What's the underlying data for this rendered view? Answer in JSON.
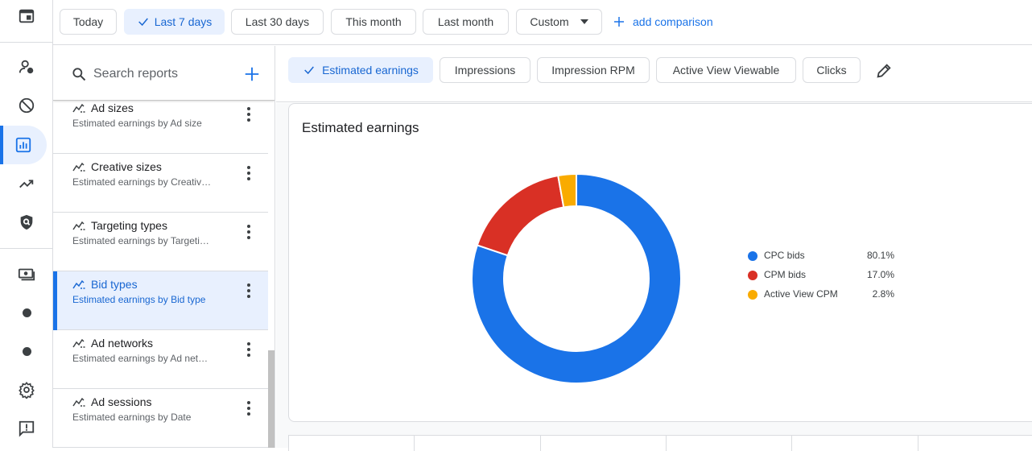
{
  "rail": {
    "items": [
      {
        "name": "home-icon"
      },
      {
        "name": "account-icon"
      },
      {
        "name": "block-icon"
      },
      {
        "name": "reports-icon"
      },
      {
        "name": "trend-icon"
      },
      {
        "name": "privacy-icon"
      },
      {
        "name": "payments-icon"
      },
      {
        "name": "dot-icon"
      },
      {
        "name": "dot-icon"
      },
      {
        "name": "settings-icon"
      },
      {
        "name": "feedback-icon"
      }
    ]
  },
  "date_filters": {
    "chips": [
      {
        "label": "Today",
        "selected": false
      },
      {
        "label": "Last 7 days",
        "selected": true
      },
      {
        "label": "Last 30 days",
        "selected": false
      },
      {
        "label": "This month",
        "selected": false
      },
      {
        "label": "Last month",
        "selected": false
      },
      {
        "label": "Custom",
        "selected": false
      }
    ],
    "add_comparison": "add comparison"
  },
  "reports": {
    "search_placeholder": "Search reports",
    "items": [
      {
        "title": "Ad sizes",
        "subtitle": "Estimated earnings by Ad size",
        "active": false
      },
      {
        "title": "Creative sizes",
        "subtitle": "Estimated earnings by Creativ…",
        "active": false
      },
      {
        "title": "Targeting types",
        "subtitle": "Estimated earnings by Targeti…",
        "active": false
      },
      {
        "title": "Bid types",
        "subtitle": "Estimated earnings by Bid type",
        "active": true
      },
      {
        "title": "Ad networks",
        "subtitle": "Estimated earnings by Ad net…",
        "active": false
      },
      {
        "title": "Ad sessions",
        "subtitle": "Estimated earnings by Date",
        "active": false
      }
    ]
  },
  "metrics": {
    "tabs": [
      {
        "label": "Estimated earnings",
        "selected": true
      },
      {
        "label": "Impressions",
        "selected": false
      },
      {
        "label": "Impression RPM",
        "selected": false
      },
      {
        "label": "Active View Viewable",
        "selected": false
      },
      {
        "label": "Clicks",
        "selected": false
      }
    ]
  },
  "chart_card": {
    "title": "Estimated earnings"
  },
  "chart_data": {
    "type": "pie",
    "title": "Estimated earnings",
    "categories": [
      "CPC bids",
      "CPM bids",
      "Active View CPM"
    ],
    "values": [
      80.1,
      17.0,
      2.8
    ],
    "labels": [
      "80.1%",
      "17.0%",
      "2.8%"
    ],
    "colors": [
      "#1a73e8",
      "#d93025",
      "#f9ab00"
    ],
    "legend_position": "right"
  }
}
